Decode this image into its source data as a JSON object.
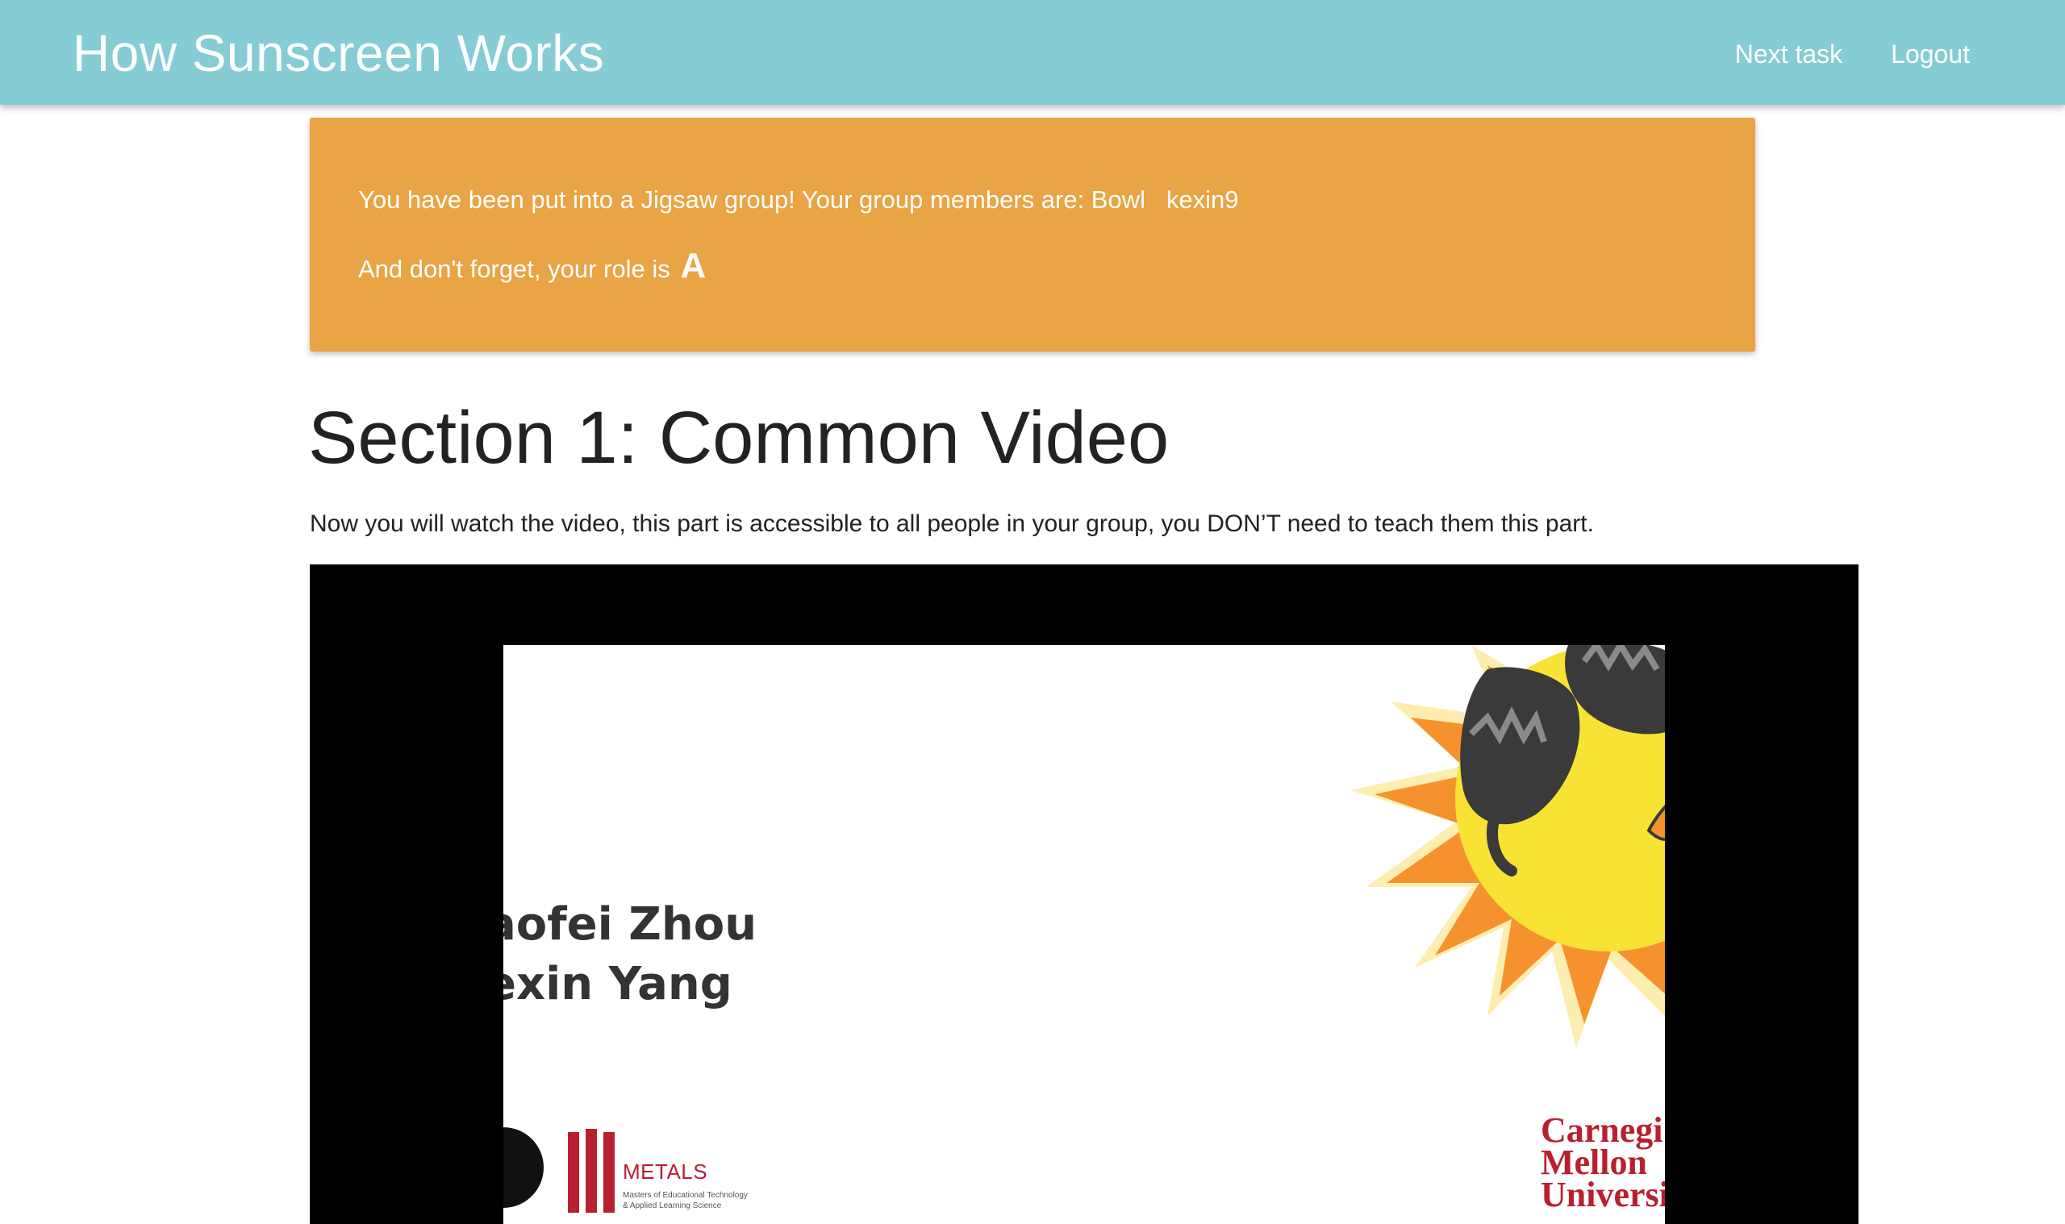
{
  "app": {
    "title": "How Sunscreen Works"
  },
  "nav": {
    "next_task": "Next task",
    "logout": "Logout"
  },
  "alert": {
    "group_text": "You have been put into a Jigsaw group! Your group members are: Bowl   kexin9",
    "role_prefix": "And don't forget, your role is",
    "role": "A"
  },
  "section": {
    "title": "Section 1: Common Video",
    "description": "Now you will watch the video, this part is accessible to all people in your group, you DON’T need to teach them this part."
  },
  "video": {
    "author_1": "aofei Zhou",
    "author_2": "exin Yang",
    "metals_name": "METALS",
    "metals_subtitle": "Masters of Educational Technology\n& Applied Learning Science",
    "university": "Carnegi\nMellon\nUniversi",
    "logo_glyph": "ʼ))"
  },
  "colors": {
    "navbar": "#86ccd4",
    "alert": "#e9a445",
    "cmu_red": "#b8202f"
  }
}
